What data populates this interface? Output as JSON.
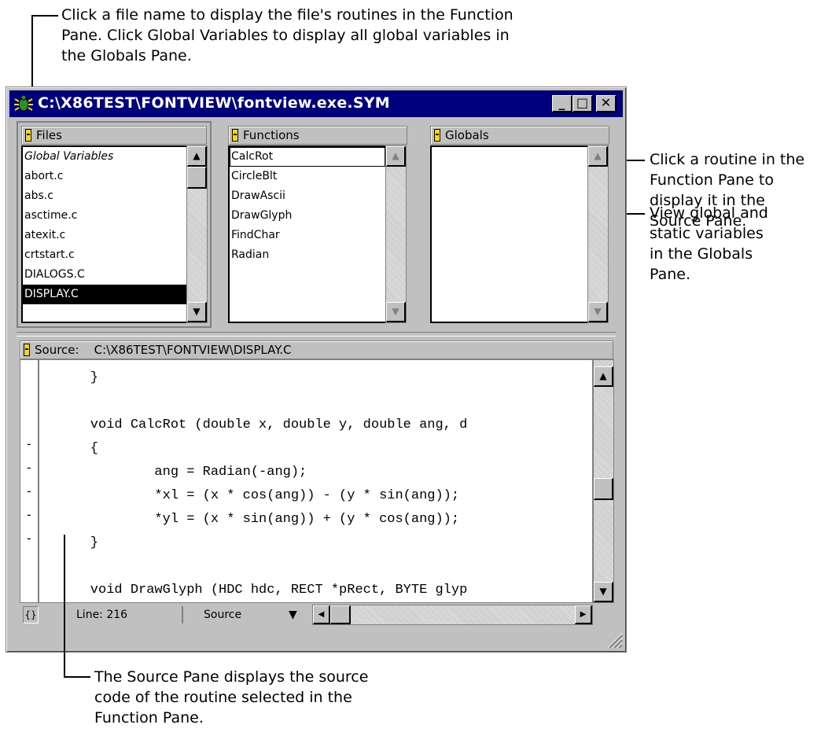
{
  "annotations": {
    "top": "Click a file name to display the file's routines in the Function\nPane. Click Global Variables to display all global variables in\nthe Globals Pane.",
    "right_function": "Click a routine in the\nFunction Pane to\ndisplay it in the\nSource Pane.",
    "right_globals": "View global and\nstatic variables\nin the Globals\nPane.",
    "bottom": "The Source Pane displays the source\ncode of the routine selected in the\nFunction Pane."
  },
  "window": {
    "title": "C:\\X86TEST\\FONTVIEW\\fontview.exe.SYM",
    "minimize": "_",
    "maximize": "□",
    "close": "✕"
  },
  "files_pane": {
    "header": "Files",
    "items": [
      "Global Variables",
      "abort.c",
      "abs.c",
      "asctime.c",
      "atexit.c",
      "crtstart.c",
      "DIALOGS.C",
      "DISPLAY.C"
    ]
  },
  "functions_pane": {
    "header": "Functions",
    "items": [
      "CalcRot",
      "CircleBlt",
      "DrawAscii",
      "DrawGlyph",
      "FindChar",
      "Radian"
    ]
  },
  "globals_pane": {
    "header": "Globals",
    "items": []
  },
  "source_pane": {
    "header": "Source:    C:\\X86TEST\\FONTVIEW\\DISPLAY.C",
    "lines": [
      "    }",
      "",
      "    void CalcRot (double x, double y, double ang, d",
      "    {",
      "            ang = Radian(-ang);",
      "            *xl = (x * cos(ang)) - (y * sin(ang));",
      "            *yl = (x * sin(ang)) + (y * cos(ang));",
      "    }",
      "",
      "    void DrawGlyph (HDC hdc, RECT *pRect, BYTE glyp"
    ],
    "gutter": [
      "",
      "",
      "",
      "-",
      "-",
      "-",
      "-",
      "-",
      "",
      ""
    ]
  },
  "status_bar": {
    "icon": "{}",
    "line": "Line: 216",
    "view": "Source"
  },
  "icons": {
    "app": "bug-icon",
    "scroll_up": "▲",
    "scroll_down": "▼",
    "scroll_left": "◀",
    "scroll_right": "▶",
    "dropdown": "▼"
  }
}
